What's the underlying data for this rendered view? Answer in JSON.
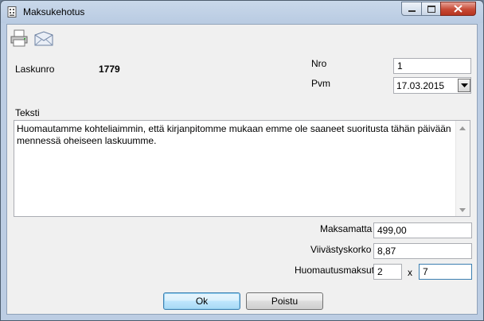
{
  "window": {
    "title": "Maksukehotus"
  },
  "toolbar": {
    "print_icon": "printer-icon",
    "email_icon": "envelope-icon"
  },
  "form": {
    "laskunro_label": "Laskunro",
    "laskunro_value": "1779",
    "nro_label": "Nro",
    "nro_value": "1",
    "pvm_label": "Pvm",
    "pvm_value": "17.03.2015",
    "teksti_label": "Teksti",
    "teksti_value": "Huomautamme kohteliaimmin, että kirjanpitomme mukaan emme ole saaneet suoritusta tähän päivään mennessä oheiseen laskuumme.",
    "maksamatta_label": "Maksamatta",
    "maksamatta_value": "499,00",
    "viivastyskorko_label": "Viivästyskorko",
    "viivastyskorko_value": "8,87",
    "huomautusmaksut_label": "Huomautusmaksut",
    "huomautusmaksut_count": "2",
    "times_label": "x",
    "huomautusmaksut_amount": "7"
  },
  "buttons": {
    "ok": "Ok",
    "poistu": "Poistu"
  }
}
